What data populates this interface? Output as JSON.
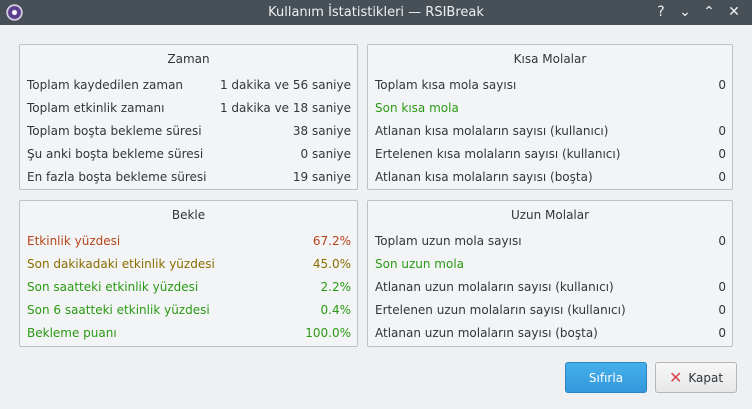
{
  "window": {
    "title": "Kullanım İstatistikleri — RSIBreak",
    "controls": {
      "help": "?",
      "minimize": "⌄",
      "maximize": "⌃",
      "close": "✕"
    }
  },
  "panels": {
    "zaman": {
      "title": "Zaman",
      "rows": [
        {
          "label": "Toplam kaydedilen zaman",
          "value": "1 dakika ve 56 saniye"
        },
        {
          "label": "Toplam etkinlik zamanı",
          "value": "1 dakika ve 18 saniye"
        },
        {
          "label": "Toplam boşta bekleme süresi",
          "value": "38 saniye"
        },
        {
          "label": "Şu anki boşta bekleme süresi",
          "value": "0 saniye"
        },
        {
          "label": "En fazla boşta bekleme süresi",
          "value": "19 saniye"
        }
      ]
    },
    "kisa": {
      "title": "Kısa Molalar",
      "rows": [
        {
          "label": "Toplam kısa mola sayısı",
          "value": "0"
        },
        {
          "label": "Son kısa mola",
          "value": ""
        },
        {
          "label": "Atlanan kısa molaların sayısı (kullanıcı)",
          "value": "0"
        },
        {
          "label": "Ertelenen kısa molaların sayısı (kullanıcı)",
          "value": "0"
        },
        {
          "label": "Atlanan kısa molaların sayısı (boşta)",
          "value": "0"
        }
      ]
    },
    "bekle": {
      "title": "Bekle",
      "rows": [
        {
          "label": "Etkinlik yüzdesi",
          "value": "67.2%"
        },
        {
          "label": "Son dakikadaki etkinlik yüzdesi",
          "value": "45.0%"
        },
        {
          "label": "Son saatteki etkinlik yüzdesi",
          "value": "2.2%"
        },
        {
          "label": "Son 6 saatteki etkinlik yüzdesi",
          "value": "0.4%"
        },
        {
          "label": "Bekleme puanı",
          "value": "100.0%"
        }
      ]
    },
    "uzun": {
      "title": "Uzun Molalar",
      "rows": [
        {
          "label": "Toplam uzun mola sayısı",
          "value": "0"
        },
        {
          "label": "Son uzun mola",
          "value": ""
        },
        {
          "label": "Atlanan uzun molaların sayısı (kullanıcı)",
          "value": "0"
        },
        {
          "label": "Ertelenen uzun molaların sayısı (kullanıcı)",
          "value": "0"
        },
        {
          "label": "Atlanan uzun molaların sayısı (boşta)",
          "value": "0"
        }
      ]
    }
  },
  "buttons": {
    "reset": "Sıfırla",
    "close": "Kapat"
  },
  "colors": {
    "titlebar": "#475057",
    "accent": "#3498db",
    "activity_red": "#b5441a",
    "activity_olive": "#8a6d00",
    "activity_green": "#2a9a15",
    "close_icon": "#da4453"
  }
}
